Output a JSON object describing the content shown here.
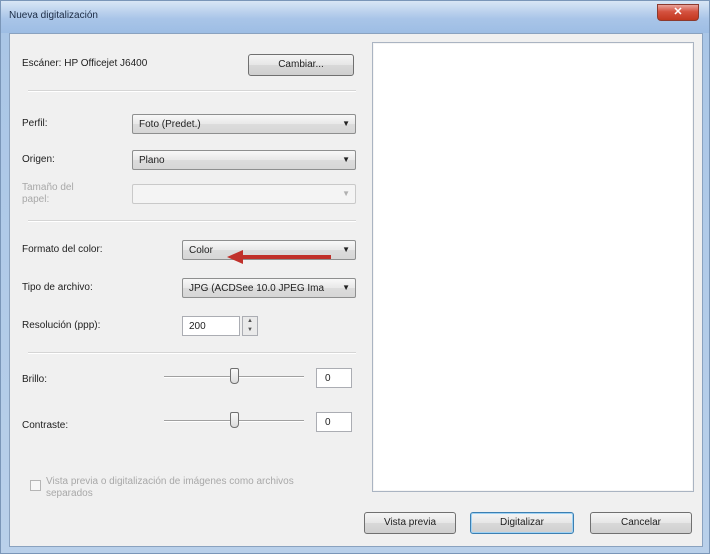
{
  "window": {
    "title": "Nueva digitalización",
    "close_glyph": "✕"
  },
  "scanner": {
    "label": "Escáner: HP Officejet J6400",
    "change_button": "Cambiar..."
  },
  "profile": {
    "label": "Perfil:",
    "value": "Foto (Predet.)"
  },
  "source": {
    "label": "Origen:",
    "value": "Plano"
  },
  "paper_size": {
    "label": "Tamaño del papel:",
    "value": ""
  },
  "color_format": {
    "label": "Formato del color:",
    "value": "Color"
  },
  "file_type": {
    "label": "Tipo de archivo:",
    "value": "JPG (ACDSee 10.0 JPEG Ima"
  },
  "resolution": {
    "label": "Resolución (ppp):",
    "value": "200"
  },
  "brightness": {
    "label": "Brillo:",
    "value": "0"
  },
  "contrast": {
    "label": "Contraste:",
    "value": "0"
  },
  "separate_files": {
    "label": "Vista previa o digitalización de imágenes como archivos separados",
    "checked": false
  },
  "footer": {
    "preview_button": "Vista previa",
    "scan_button": "Digitalizar",
    "cancel_button": "Cancelar"
  },
  "icons": {
    "dropdown": "chevron-down-icon",
    "spin_up": "spin-up-icon",
    "spin_down": "spin-down-icon",
    "annotation": "red-arrow-icon"
  },
  "colors": {
    "annotation_arrow": "#c0302a",
    "titlebar": "#a9c5e8",
    "close_button": "#c2371f"
  }
}
